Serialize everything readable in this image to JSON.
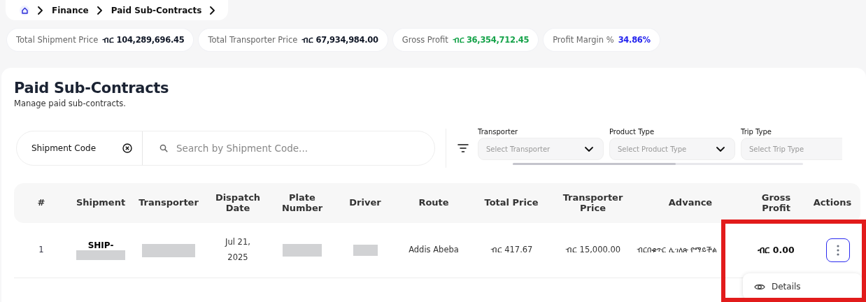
{
  "breadcrumb": [
    "Finance",
    "Paid Sub-Contracts"
  ],
  "stats": [
    {
      "label": "Total Shipment Price",
      "value": "ብር 104,289,696.45",
      "color": "#111827"
    },
    {
      "label": "Total Transporter Price",
      "value": "ብር 67,934,984.00",
      "color": "#111827"
    },
    {
      "label": "Gross Profit",
      "value": "ብር 36,354,712.45",
      "color": "#16a34a"
    },
    {
      "label": "Profit Margin %",
      "value": "34.86%",
      "color": "#2323ee"
    }
  ],
  "page": {
    "title": "Paid Sub-Contracts",
    "subtitle": "Manage paid sub-contracts."
  },
  "search": {
    "field": "Shipment Code",
    "placeholder": "Search by Shipment Code..."
  },
  "filters": [
    {
      "label": "Transporter",
      "placeholder": "Select Transporter"
    },
    {
      "label": "Product Type",
      "placeholder": "Select Product Type"
    },
    {
      "label": "Trip Type",
      "placeholder": "Select Trip Type"
    }
  ],
  "table": {
    "columns": [
      "#",
      "Shipment",
      "Transporter",
      "Dispatch Date",
      "Plate Number",
      "Driver",
      "Route",
      "Total Price",
      "Transporter Price",
      "Advance",
      "Gross Profit",
      "Actions"
    ],
    "rows": [
      {
        "cells": [
          {
            "kind": "text",
            "text": "1"
          },
          {
            "kind": "code",
            "text": "SHIP-"
          },
          {
            "kind": "redacted"
          },
          {
            "kind": "text",
            "text": "Jul 21, 2025"
          },
          {
            "kind": "redacted"
          },
          {
            "kind": "redacted"
          },
          {
            "kind": "text",
            "text": "Addis Abeba"
          },
          {
            "kind": "text",
            "text": "ብር 417.67"
          },
          {
            "kind": "text",
            "text": "ብር 15,000.00"
          },
          {
            "kind": "text",
            "text": "ብርበቁጥር ሊገለጽ የማይችል"
          },
          {
            "kind": "bold",
            "text": "ብር 0.00"
          },
          {
            "kind": "actions"
          }
        ],
        "menu_open": true,
        "menu": [
          "Details"
        ]
      }
    ]
  },
  "highlight": true
}
